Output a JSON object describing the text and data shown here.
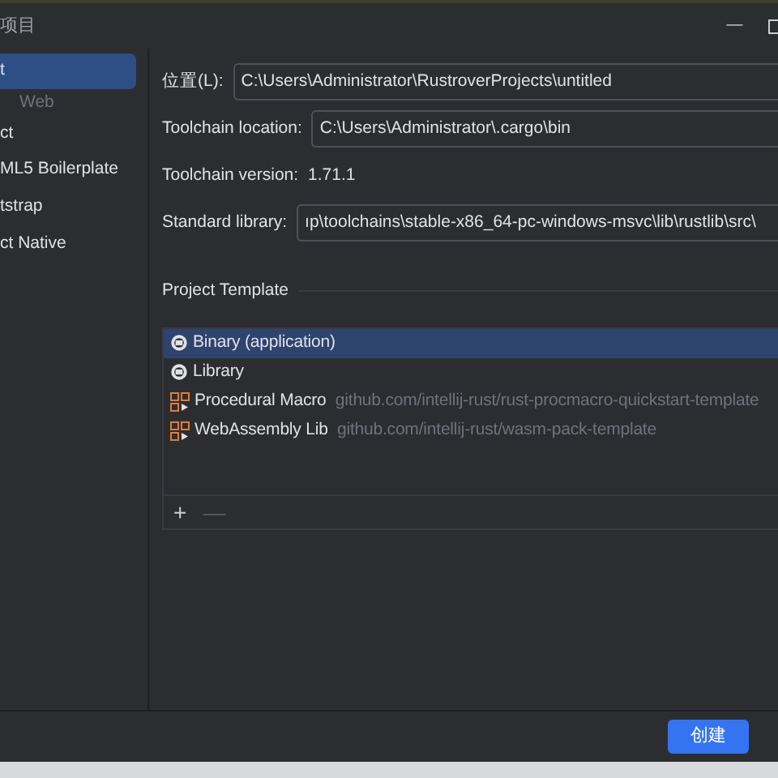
{
  "window": {
    "title": "项目",
    "controls": [
      {
        "kind": "minimize",
        "label": "—"
      },
      {
        "kind": "maximize"
      }
    ]
  },
  "sidebar": {
    "items": [
      {
        "kind": "item",
        "label": "t",
        "selected": true
      },
      {
        "kind": "group",
        "label": "Web"
      },
      {
        "kind": "item",
        "label": "ct",
        "selected": false
      },
      {
        "kind": "item",
        "label": "ML5 Boilerplate",
        "selected": false
      },
      {
        "kind": "item",
        "label": "tstrap",
        "selected": false
      },
      {
        "kind": "item",
        "label": "ct Native",
        "selected": false
      }
    ]
  },
  "form": [
    {
      "kind": "field",
      "label": "位置(L):",
      "value": "C:\\Users\\Administrator\\RustroverProjects\\untitled"
    },
    {
      "kind": "field",
      "label": "Toolchain location:",
      "value": "C:\\Users\\Administrator\\.cargo\\bin"
    },
    {
      "kind": "text",
      "label": "Toolchain version:",
      "value": "1.71.1"
    },
    {
      "kind": "field",
      "label": "Standard library:",
      "value": "ıp\\toolchains\\stable-x86_64-pc-windows-msvc\\lib\\rustlib\\src\\"
    }
  ],
  "project_template": {
    "title": "Project Template",
    "items": [
      {
        "kind": "builtin",
        "name": "Binary (application)",
        "selected": true
      },
      {
        "kind": "builtin",
        "name": "Library",
        "selected": false
      },
      {
        "kind": "github",
        "name": "Procedural Macro",
        "url": "github.com/intellij-rust/rust-procmacro-quickstart-template",
        "selected": false
      },
      {
        "kind": "github",
        "name": "WebAssembly Lib",
        "url": "github.com/intellij-rust/wasm-pack-template",
        "selected": false
      }
    ],
    "toolbar": [
      {
        "label": "+",
        "disabled": false
      },
      {
        "label": "—",
        "disabled": true
      }
    ]
  },
  "buttons": [
    {
      "label": "创建",
      "primary": true
    }
  ]
}
